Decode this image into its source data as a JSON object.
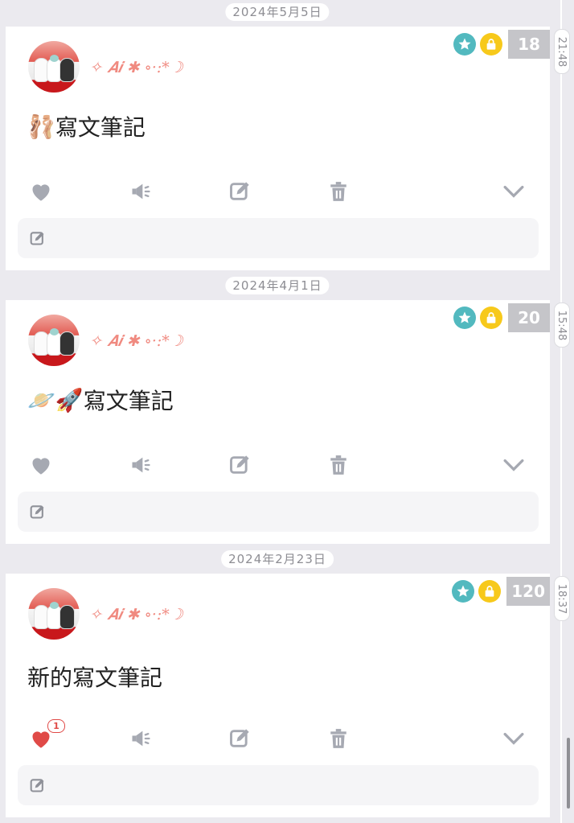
{
  "entries": [
    {
      "date": "2024年5月5日",
      "time": "21:48",
      "username": "✧ 𝑨𝒊 ✱ ∘·:*☽",
      "count": "18",
      "emoji": "🩰",
      "title": "寫文筆記",
      "likes": "",
      "liked": false
    },
    {
      "date": "2024年4月1日",
      "time": "15:48",
      "username": "✧ 𝑨𝒊 ✱ ∘·:*☽",
      "count": "20",
      "emoji": "🪐🚀",
      "title": "寫文筆記",
      "likes": "",
      "liked": false
    },
    {
      "date": "2024年2月23日",
      "time": "18:37",
      "username": "✧ 𝑨𝒊 ✱ ∘·:*☽",
      "count": "120",
      "emoji": "",
      "title": "新的寫文筆記",
      "likes": "1",
      "liked": true
    }
  ],
  "icons": {
    "star": "star-icon",
    "lock": "lock-icon",
    "like": "heart-icon",
    "speak": "speaker-icon",
    "edit": "edit-icon",
    "delete": "trash-icon",
    "more": "chevron-down-icon",
    "comment": "comment-edit-icon"
  },
  "colors": {
    "background": "#ebeaef",
    "accent_teal": "#52b9bf",
    "accent_yellow": "#f7c91b",
    "username_pink": "#f08a80",
    "liked_red": "#e04a47",
    "icon_gray": "#a6a9b2"
  }
}
